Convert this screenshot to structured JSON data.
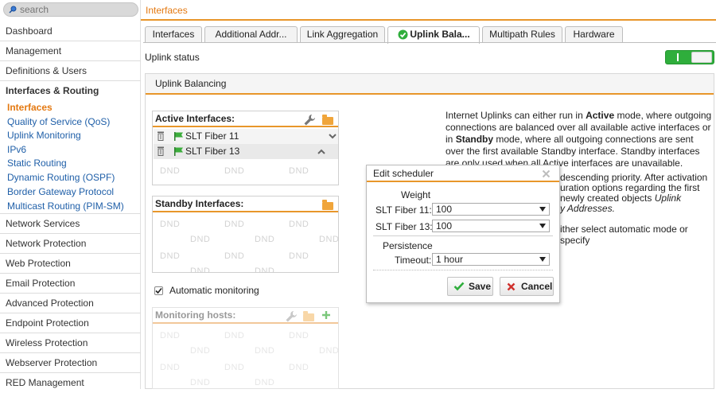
{
  "search": {
    "placeholder": "search"
  },
  "sidebar": {
    "items": [
      {
        "label": "Dashboard"
      },
      {
        "label": "Management"
      },
      {
        "label": "Definitions & Users"
      },
      {
        "label": "Interfaces & Routing"
      },
      {
        "label": "Network Services"
      },
      {
        "label": "Network Protection"
      },
      {
        "label": "Web Protection"
      },
      {
        "label": "Email Protection"
      },
      {
        "label": "Advanced Protection"
      },
      {
        "label": "Endpoint Protection"
      },
      {
        "label": "Wireless Protection"
      },
      {
        "label": "Webserver Protection"
      },
      {
        "label": "RED Management"
      }
    ],
    "subitems": [
      {
        "label": "Interfaces",
        "active": true
      },
      {
        "label": "Quality of Service (QoS)"
      },
      {
        "label": "Uplink Monitoring"
      },
      {
        "label": "IPv6"
      },
      {
        "label": "Static Routing"
      },
      {
        "label": "Dynamic Routing (OSPF)"
      },
      {
        "label": "Border Gateway Protocol"
      },
      {
        "label": "Multicast Routing (PIM-SM)"
      }
    ]
  },
  "header": {
    "breadcrumb": "Interfaces"
  },
  "tabs": [
    {
      "label": "Interfaces"
    },
    {
      "label": "Additional Addr..."
    },
    {
      "label": "Link Aggregation"
    },
    {
      "label": "Uplink Bala...",
      "active": true
    },
    {
      "label": "Multipath Rules"
    },
    {
      "label": "Hardware"
    }
  ],
  "uplink_status": {
    "label": "Uplink status",
    "enabled": true
  },
  "panel": {
    "title": "Uplink Balancing"
  },
  "active_interfaces": {
    "title": "Active Interfaces:",
    "rows": [
      {
        "label": "SLT Fiber 11"
      },
      {
        "label": "SLT Fiber 13"
      }
    ],
    "dnd": "DND"
  },
  "standby_interfaces": {
    "title": "Standby Interfaces:",
    "dnd": "DND"
  },
  "auto_monitoring": {
    "label": "Automatic monitoring",
    "checked": true
  },
  "monitoring_hosts": {
    "title": "Monitoring hosts:",
    "dnd": "DND"
  },
  "description": {
    "p1_a": "Internet Uplinks can either run in ",
    "p1_b": "Active",
    "p1_c": " mode, where outgoing connections are balanced over all available active interfaces or in ",
    "p1_d": "Standby",
    "p1_e": " mode, where all outgoing connections are sent over the first available Standby interface. Standby interfaces are only used when all Active interfaces are unavailable.",
    "p2_a": "descending priority. After activation",
    "p2_b": "uration options regarding the first",
    "p2_c": "newly created objects ",
    "p2_d": "Uplink",
    "p2_e": "y Addresses.",
    "p3": "ither select automatic mode or specify"
  },
  "dialog": {
    "title": "Edit scheduler",
    "weight_label": "Weight",
    "fields": [
      {
        "label": "SLT Fiber 11:",
        "value": "100"
      },
      {
        "label": "SLT Fiber 13:",
        "value": "100"
      }
    ],
    "persistence_label": "Persistence",
    "timeout_label": "Timeout:",
    "timeout_value": "1 hour",
    "save_label": "Save",
    "cancel_label": "Cancel"
  },
  "colors": {
    "accent": "#e8962a",
    "link": "#1f5fa8",
    "active_nav": "#e47911",
    "toggle_on": "#2fae3c"
  }
}
